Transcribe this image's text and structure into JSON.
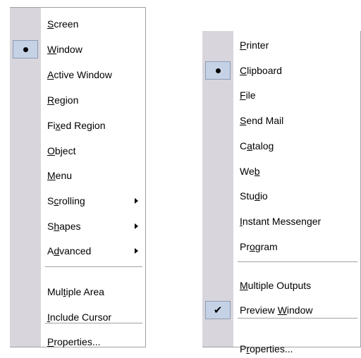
{
  "capture_menu": {
    "items": [
      {
        "label": "Screen",
        "mnemonic": "S",
        "checked": false,
        "submenu": false
      },
      {
        "label": "Window",
        "mnemonic": "W",
        "checked": "bullet",
        "submenu": false
      },
      {
        "label": "Active Window",
        "mnemonic": "A",
        "checked": false,
        "submenu": false
      },
      {
        "label": "Region",
        "mnemonic": "R",
        "checked": false,
        "submenu": false
      },
      {
        "label": "Fixed Region",
        "mnemonic": "x",
        "checked": false,
        "submenu": false
      },
      {
        "label": "Object",
        "mnemonic": "O",
        "checked": false,
        "submenu": false
      },
      {
        "label": "Menu",
        "mnemonic": "M",
        "checked": false,
        "submenu": false
      },
      {
        "label": "Scrolling",
        "mnemonic": "c",
        "checked": false,
        "submenu": true
      },
      {
        "label": "Shapes",
        "mnemonic": "h",
        "checked": false,
        "submenu": true
      },
      {
        "label": "Advanced",
        "mnemonic": "d",
        "checked": false,
        "submenu": true
      },
      {
        "separator": true
      },
      {
        "label": "Multiple Area",
        "mnemonic": "t",
        "checked": false,
        "submenu": false
      },
      {
        "label": "Include Cursor",
        "mnemonic": "I",
        "checked": false,
        "submenu": false
      },
      {
        "separator": true
      },
      {
        "label": "Properties...",
        "mnemonic": "P",
        "checked": false,
        "submenu": false
      }
    ]
  },
  "output_menu": {
    "items": [
      {
        "label": "Printer",
        "mnemonic": "P",
        "checked": false
      },
      {
        "label": "Clipboard",
        "mnemonic": "C",
        "checked": "bullet"
      },
      {
        "label": "File",
        "mnemonic": "F",
        "checked": false
      },
      {
        "label": "Send Mail",
        "mnemonic": "S",
        "checked": false
      },
      {
        "label": "Catalog",
        "mnemonic": "a",
        "checked": false
      },
      {
        "label": "Web",
        "mnemonic": "b",
        "checked": false
      },
      {
        "label": "Studio",
        "mnemonic": "d",
        "checked": false
      },
      {
        "label": "Instant Messenger",
        "mnemonic": "I",
        "checked": false
      },
      {
        "label": "Program",
        "mnemonic": "o",
        "checked": false
      },
      {
        "separator": true
      },
      {
        "label": "Multiple Outputs",
        "mnemonic": "M",
        "checked": false
      },
      {
        "label": "Preview Window",
        "mnemonic": "W",
        "checked": "check"
      },
      {
        "separator": true
      },
      {
        "label": "Properties...",
        "mnemonic": "r",
        "checked": false
      }
    ]
  },
  "icons": {
    "bullet": "radio-bullet-icon",
    "check": "checkmark-icon",
    "submenu": "submenu-arrow-icon"
  },
  "colors": {
    "gutter": "#d8d5dc",
    "highlight": "#c5d2e6",
    "highlight_border": "#8b9bb4",
    "separator": "#a0a0a0"
  }
}
